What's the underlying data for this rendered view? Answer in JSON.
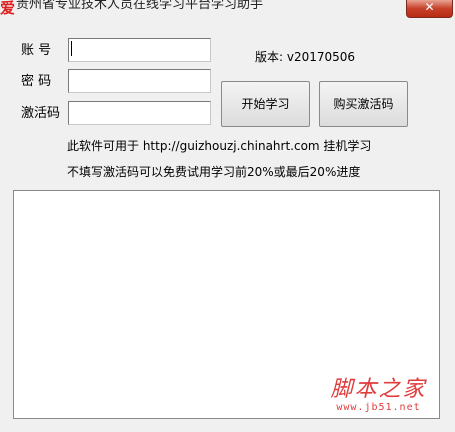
{
  "window": {
    "title": "贵州省专业技术人员在线学习平台学习助手",
    "app_icon_glyph": "爱",
    "close_glyph": "✕"
  },
  "form": {
    "account_label": "账  号",
    "password_label": "密  码",
    "activation_label": "激活码",
    "account_value": "",
    "password_value": "",
    "activation_value": ""
  },
  "version": {
    "text": "版本: v20170506"
  },
  "buttons": {
    "start_label": "开始学习",
    "buy_label": "购买激活码"
  },
  "info": {
    "line1": "此软件可用于 http://guizhouzj.chinahrt.com 挂机学习",
    "line2": "不填写激活码可以免费试用学习前20%或最后20%进度"
  },
  "log": {
    "content": ""
  },
  "watermark": {
    "name": "脚本之家",
    "url": "www.jb51.net"
  },
  "colors": {
    "window_bg": "#f0f0f0",
    "close_red": "#c8412a",
    "watermark_red": "#e03c3c"
  }
}
